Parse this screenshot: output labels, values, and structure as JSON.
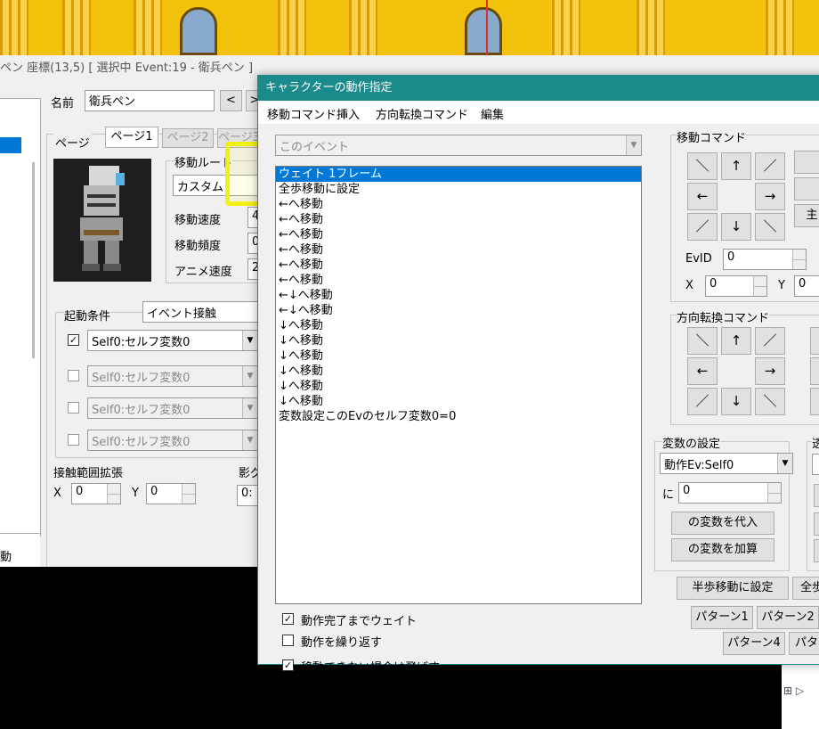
{
  "editor": {
    "title": "ペン 座標(13,5) [ 選択中 Event:19 - 衛兵ペン ]",
    "name_label": "名前",
    "name_value": "衛兵ペン",
    "prev_btn": "<",
    "next_btn": ">",
    "page_label": "ページ",
    "tabs": [
      "ページ1",
      "ページ2",
      "ページ3"
    ],
    "move_route_label": "移動ルート",
    "move_type": "カスタム",
    "move_speed_label": "移動速度",
    "move_speed_value": "4",
    "move_freq_label": "移動頻度",
    "move_freq_value": "0",
    "anim_speed_label": "アニメ速度",
    "anim_speed_value": "2",
    "trigger_label": "起動条件",
    "trigger_value": "イベント接触",
    "conditions": [
      {
        "checked": true,
        "value": "Self0:セルフ変数0"
      },
      {
        "checked": false,
        "value": "Self0:セルフ変数0"
      },
      {
        "checked": false,
        "value": "Self0:セルフ変数0"
      },
      {
        "checked": false,
        "value": "Self0:セルフ変数0"
      }
    ],
    "contact_range_label": "接触範囲拡張",
    "x_label": "X",
    "x_value": "0",
    "y_label": "Y",
    "y_value": "0",
    "shadow_label": "影グ",
    "shadow_value": "0:",
    "left_bottom_text": "動"
  },
  "dialog": {
    "title": "キャラクターの動作指定",
    "menu": [
      "移動コマンド挿入",
      "方向転換コマンド",
      "編集"
    ],
    "target": "このイベント",
    "commands": [
      "ウェイト 1フレーム",
      "全歩移動に設定",
      "←へ移動",
      "←へ移動",
      "←へ移動",
      "←へ移動",
      "←へ移動",
      "←へ移動",
      "←↓へ移動",
      "←↓へ移動",
      "↓へ移動",
      "↓へ移動",
      "↓へ移動",
      "↓へ移動",
      "↓へ移動",
      "↓へ移動",
      "変数設定このEvのセルフ変数0=0"
    ],
    "selected_index": 0,
    "options": [
      {
        "label": "動作完了までウェイト",
        "checked": true
      },
      {
        "label": "動作を繰り返す",
        "checked": false
      },
      {
        "label": "移動できない場合は飛ばす",
        "checked": true
      }
    ],
    "move_cmd_label": "移動コマンド",
    "dir_cmd_label": "方向転換コマンド",
    "arrows": [
      "＼",
      "↑",
      "／",
      "←",
      "→",
      "／",
      "↓",
      "＼"
    ],
    "evid_label": "EvID",
    "evid_value": "0",
    "x_label": "X",
    "x_value": "0",
    "y_label": "Y",
    "y_value": "0",
    "main_btn_partial": "主",
    "var_label": "変数の設定",
    "var_target": "動作Ev:Self0",
    "ni_label": "に",
    "ni_value": "0",
    "assign_btn": "の変数を代入",
    "add_btn": "の変数を加算",
    "side_label_partial": "透",
    "half_step_btn": "半歩移動に設定",
    "full_step_btn_partial": "全歩",
    "pattern_btns": [
      "パターン1",
      "パターン2",
      "パターン4",
      "パター"
    ]
  },
  "colors": {
    "dialog_title_bg": "#1a8a8a",
    "selection": "#0078d7",
    "highlight": "#f4ef15",
    "map_bg": "#f3c20a"
  }
}
